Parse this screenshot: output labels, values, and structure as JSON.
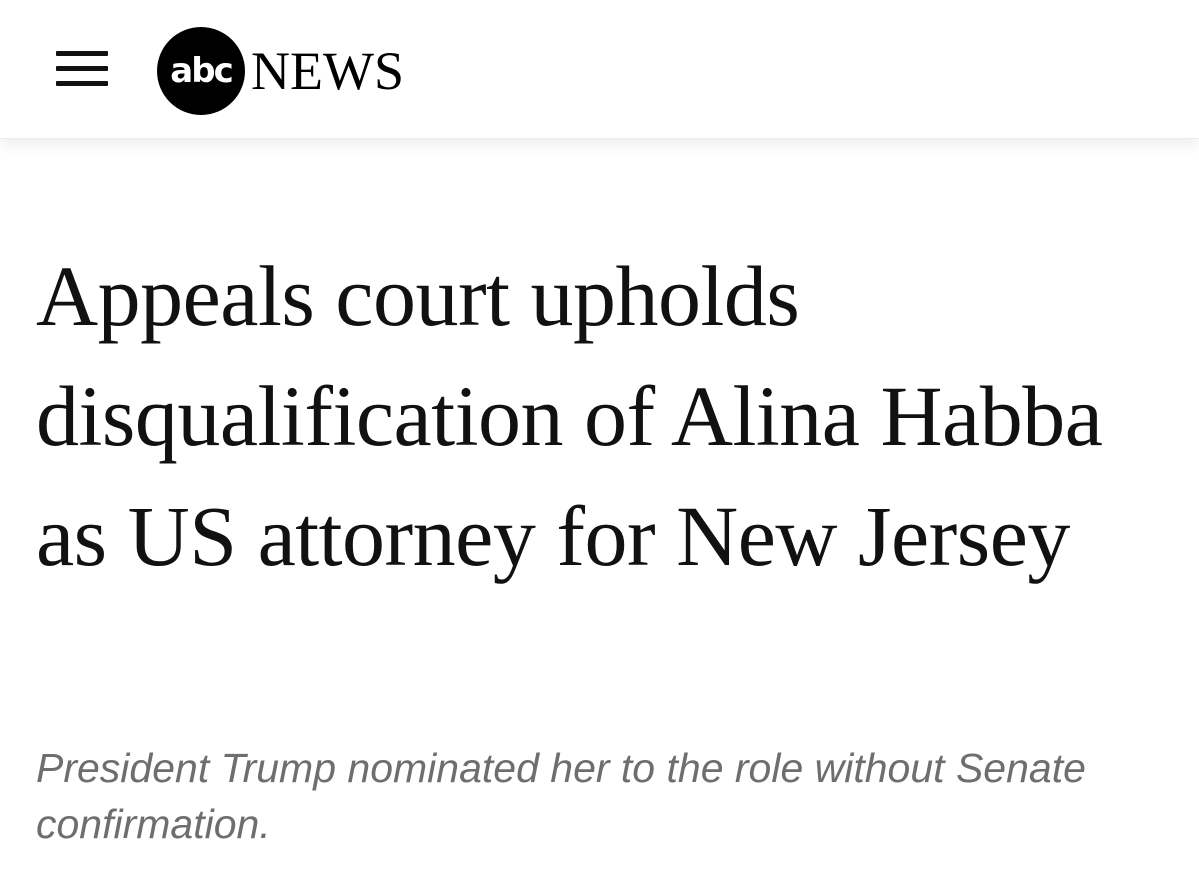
{
  "header": {
    "logo": {
      "abc_text": "abc",
      "news_text": "NEWS"
    },
    "menu_icon": "hamburger-menu-icon"
  },
  "article": {
    "headline": "Appeals court upholds disqualification of Alina Habba as US attorney for New Jersey",
    "subheadline": "President Trump nominated her to the role without Senate confirmation."
  },
  "colors": {
    "text": "#111111",
    "subhead": "#6e6e6e",
    "logo_circle": "#000000"
  }
}
